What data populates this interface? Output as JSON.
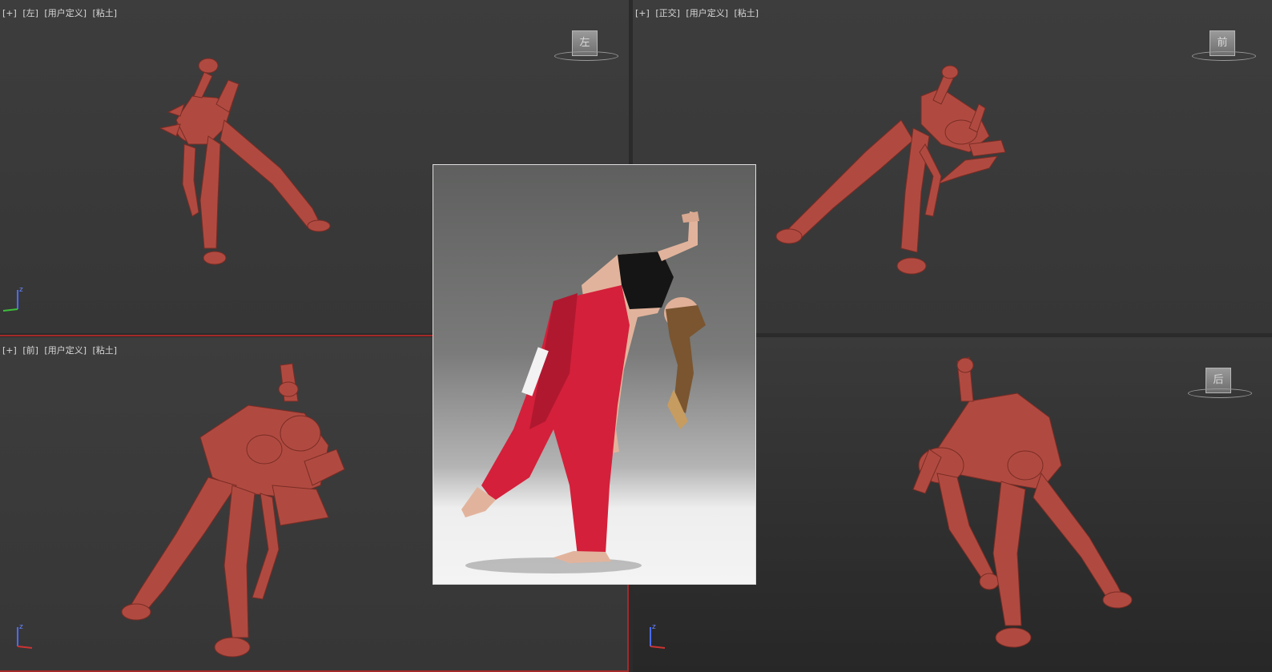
{
  "viewports": {
    "top_left": {
      "plus": "[+]",
      "view": "[左]",
      "shading": "[用户定义]",
      "style": "[粘土]",
      "cube_label": "左"
    },
    "top_right": {
      "plus": "[+]",
      "view": "[正交]",
      "shading": "[用户定义]",
      "style": "[粘土]",
      "cube_label": "前"
    },
    "bottom_left": {
      "plus": "[+]",
      "view": "[前]",
      "shading": "[用户定义]",
      "style": "[粘土]"
    },
    "bottom_right": {
      "cube_label": "后"
    }
  },
  "axis": {
    "z": "z",
    "x": "x",
    "y": "y"
  },
  "icons": [
    "viewcube-icon",
    "axis-gizmo-icon"
  ],
  "colors": {
    "viewport_bg": "#3a3a3a",
    "clay_model": "#b04a40",
    "active_border": "#a52a2a",
    "pants": "#d4203a"
  }
}
